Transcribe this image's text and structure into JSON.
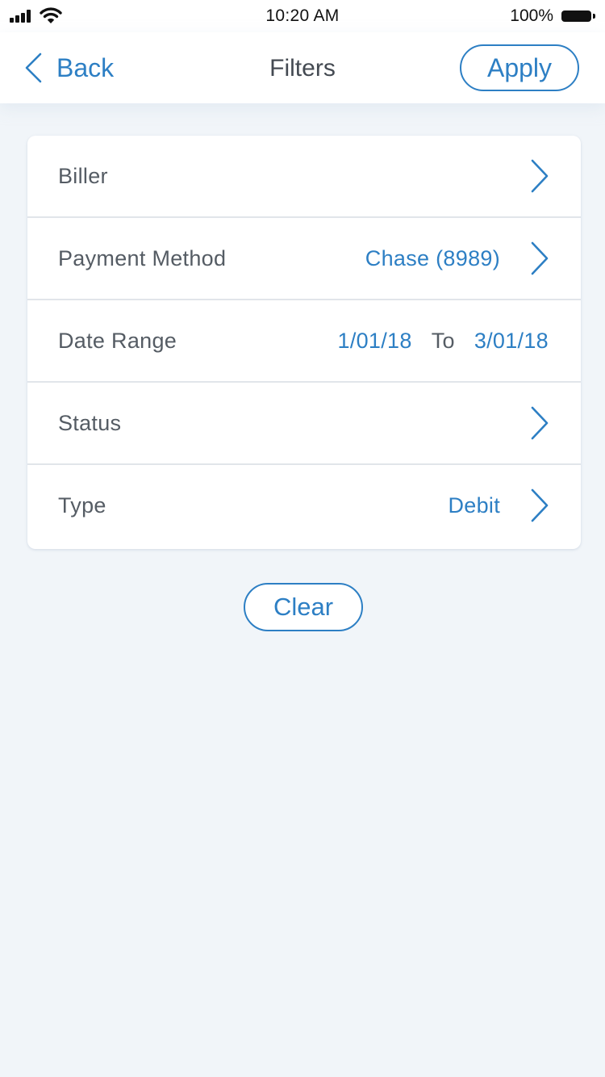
{
  "status_bar": {
    "time": "10:20 AM",
    "battery_percent": "100%",
    "icons": [
      "signal-icon",
      "wifi-icon",
      "battery-icon"
    ]
  },
  "nav": {
    "back_label": "Back",
    "title": "Filters",
    "apply_label": "Apply",
    "back_icon": "chevron-left-icon"
  },
  "filters": {
    "biller": {
      "label": "Biller",
      "value": ""
    },
    "payment_method": {
      "label": "Payment Method",
      "value": "Chase (8989)"
    },
    "date_range": {
      "label": "Date Range",
      "from": "1/01/18",
      "to_label": "To",
      "to": "3/01/18"
    },
    "status": {
      "label": "Status",
      "value": ""
    },
    "type": {
      "label": "Type",
      "value": "Debit"
    }
  },
  "clear_label": "Clear",
  "colors": {
    "accent": "#2d7fc4",
    "background": "#f1f5f9",
    "label_text": "#555c64",
    "divider": "#e1e5ea"
  }
}
